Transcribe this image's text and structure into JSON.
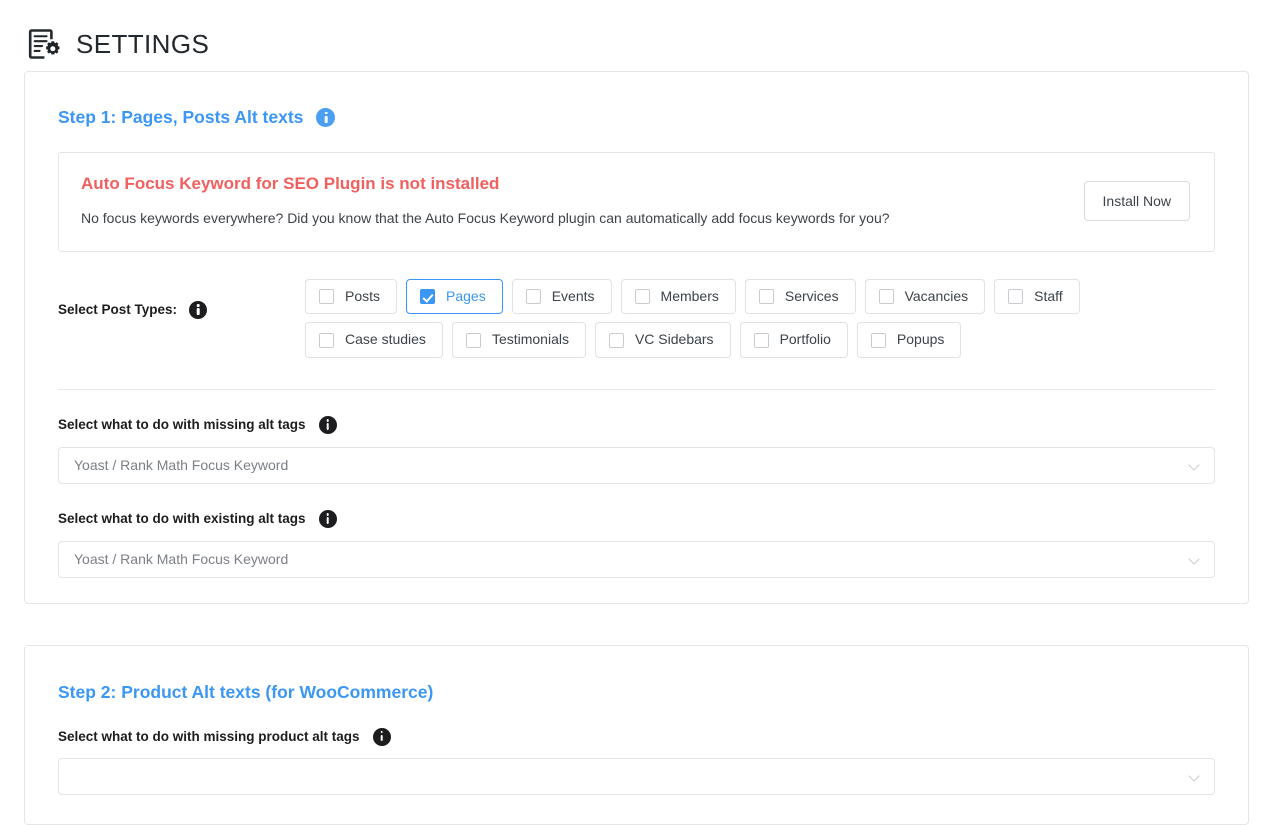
{
  "header": {
    "icon": "settings-document-gear-icon",
    "title": "SETTINGS"
  },
  "colors": {
    "accent_blue": "#3b97f3",
    "notice_red": "#f0605e",
    "border": "#e6e6e8",
    "text": "#3c434a",
    "muted": "#7b7f86"
  },
  "step1": {
    "heading": "Step 1: Pages, Posts Alt texts",
    "heading_info_icon": "info-icon",
    "notice": {
      "title": "Auto Focus Keyword for SEO Plugin is not installed",
      "body": "No focus keywords everywhere? Did you know that the Auto Focus Keyword plugin can automatically add focus keywords for you?",
      "button_label": "Install Now"
    },
    "post_types": {
      "label": "Select Post Types:",
      "info_icon": "info-icon-dark",
      "options": [
        {
          "label": "Posts",
          "checked": false
        },
        {
          "label": "Pages",
          "checked": true
        },
        {
          "label": "Events",
          "checked": false
        },
        {
          "label": "Members",
          "checked": false
        },
        {
          "label": "Services",
          "checked": false
        },
        {
          "label": "Vacancies",
          "checked": false
        },
        {
          "label": "Staff",
          "checked": false
        },
        {
          "label": "Case studies",
          "checked": false
        },
        {
          "label": "Testimonials",
          "checked": false
        },
        {
          "label": "VC Sidebars",
          "checked": false
        },
        {
          "label": "Portfolio",
          "checked": false
        },
        {
          "label": "Popups",
          "checked": false
        }
      ]
    },
    "missing_alt": {
      "label": "Select what to do with missing alt tags",
      "info_icon": "info-icon-dark",
      "value": "Yoast / Rank Math Focus Keyword",
      "chevron_icon": "chevron-down-icon"
    },
    "existing_alt": {
      "label": "Select what to do with existing alt tags",
      "info_icon": "info-icon-dark",
      "value": "Yoast / Rank Math Focus Keyword",
      "chevron_icon": "chevron-down-icon"
    }
  },
  "step2": {
    "heading": "Step 2: Product Alt texts (for WooCommerce)",
    "missing_product_alt": {
      "label": "Select what to do with missing product alt tags",
      "info_icon": "info-icon-dark"
    }
  }
}
